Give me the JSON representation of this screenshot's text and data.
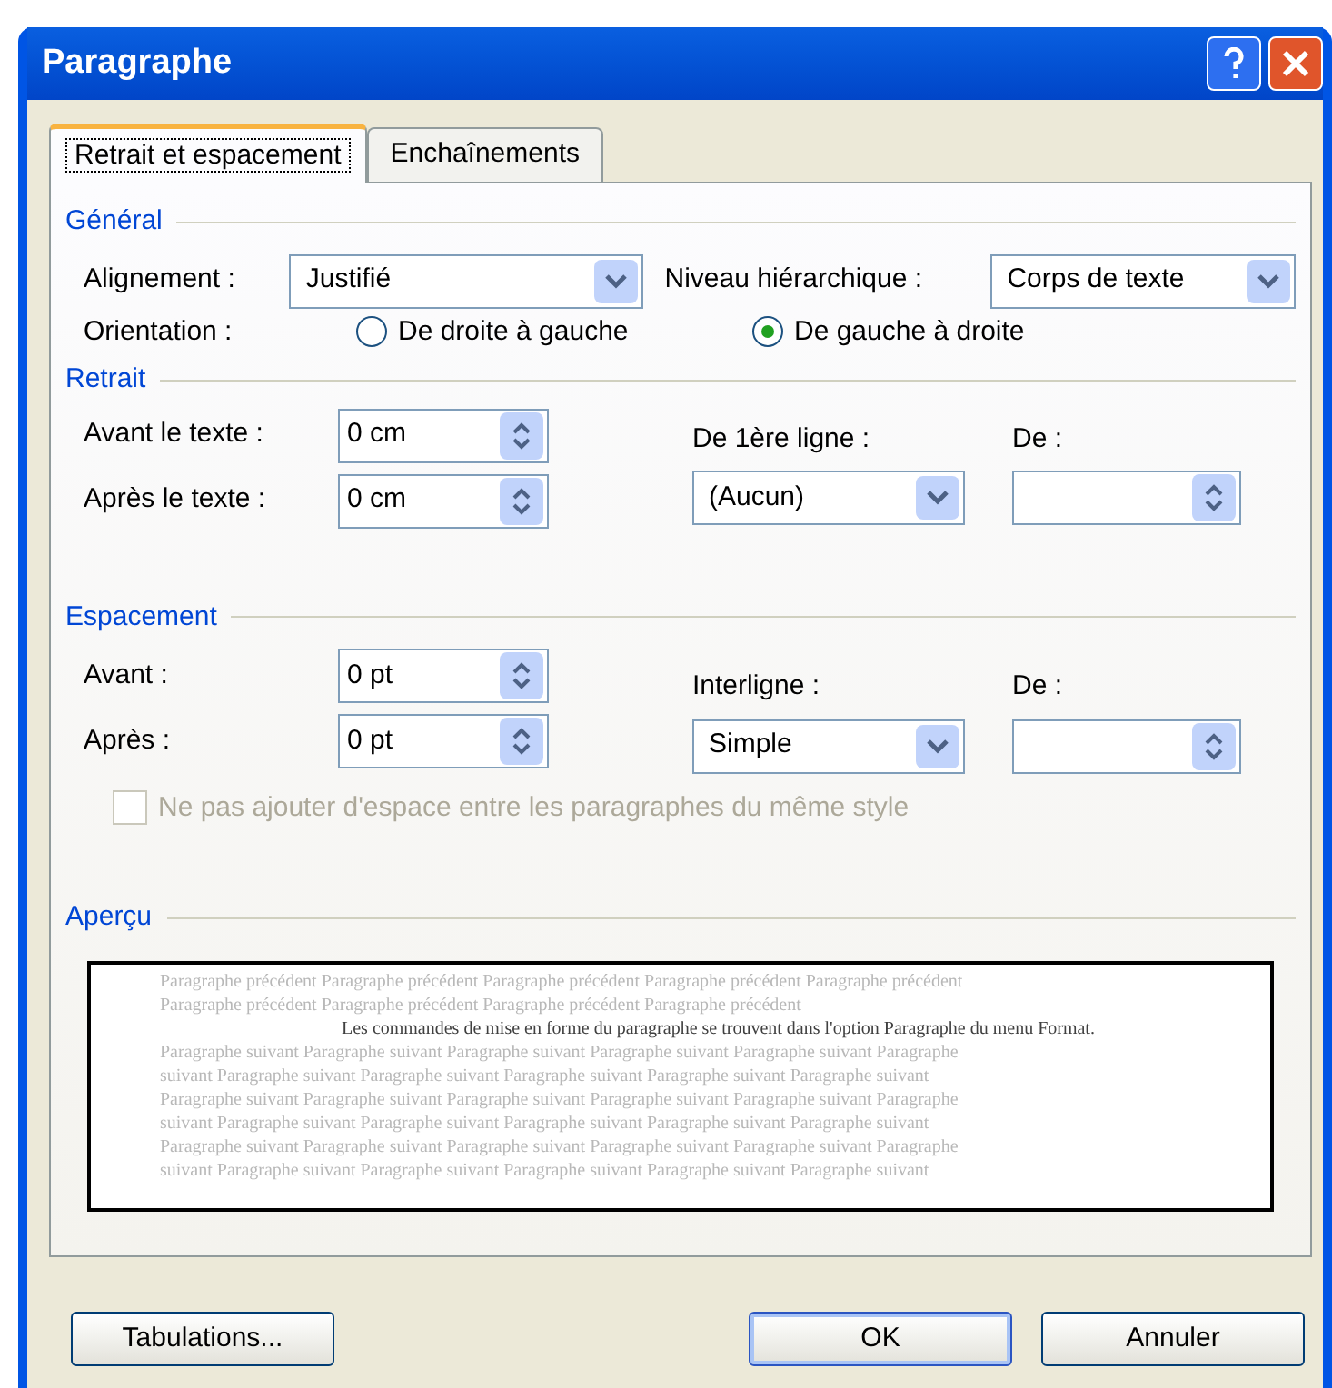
{
  "window": {
    "title": "Paragraphe"
  },
  "tabs": [
    {
      "label": "Retrait et espacement",
      "selected": true
    },
    {
      "label": "Enchaînements",
      "selected": false
    }
  ],
  "general": {
    "title": "Général",
    "alignment": {
      "label": "Alignement :",
      "value": "Justifié"
    },
    "outline_level": {
      "label": "Niveau hiérarchique :",
      "value": "Corps de texte"
    },
    "orientation": {
      "label": "Orientation :",
      "options": [
        {
          "label": "De droite à gauche",
          "selected": false
        },
        {
          "label": "De gauche à droite",
          "selected": true
        }
      ]
    }
  },
  "indent": {
    "title": "Retrait",
    "before": {
      "label": "Avant le texte :",
      "value": "0 cm"
    },
    "after": {
      "label": "Après le texte :",
      "value": "0 cm"
    },
    "first_line": {
      "label": "De 1ère ligne :",
      "value": "(Aucun)"
    },
    "by": {
      "label": "De :"
    }
  },
  "spacing": {
    "title": "Espacement",
    "before": {
      "label": "Avant :",
      "value": "0 pt"
    },
    "after": {
      "label": "Après :",
      "value": "0 pt"
    },
    "line_spacing": {
      "label": "Interligne :",
      "value": "Simple"
    },
    "at": {
      "label": "De :"
    },
    "no_space_checkbox": {
      "label": "Ne pas ajouter d'espace entre les paragraphes du même style",
      "checked": false,
      "disabled": true
    }
  },
  "preview": {
    "title": "Aperçu",
    "lines": [
      {
        "kind": "previous",
        "text": "Paragraphe précédent Paragraphe précédent Paragraphe précédent Paragraphe précédent Paragraphe précédent"
      },
      {
        "kind": "previous",
        "text": "Paragraphe précédent Paragraphe précédent Paragraphe précédent Paragraphe précédent"
      },
      {
        "kind": "current",
        "text": "Les commandes de mise en forme du paragraphe se trouvent dans l'option Paragraphe du menu Format."
      },
      {
        "kind": "following",
        "text": "Paragraphe suivant Paragraphe suivant Paragraphe suivant Paragraphe suivant Paragraphe suivant Paragraphe"
      },
      {
        "kind": "following",
        "text": "suivant Paragraphe suivant Paragraphe suivant Paragraphe suivant Paragraphe suivant Paragraphe suivant"
      },
      {
        "kind": "following",
        "text": "Paragraphe suivant Paragraphe suivant Paragraphe suivant Paragraphe suivant Paragraphe suivant Paragraphe"
      },
      {
        "kind": "following",
        "text": "suivant Paragraphe suivant Paragraphe suivant Paragraphe suivant Paragraphe suivant Paragraphe suivant"
      },
      {
        "kind": "following",
        "text": "Paragraphe suivant Paragraphe suivant Paragraphe suivant Paragraphe suivant Paragraphe suivant Paragraphe"
      },
      {
        "kind": "following",
        "text": "suivant Paragraphe suivant Paragraphe suivant Paragraphe suivant Paragraphe suivant Paragraphe suivant"
      }
    ]
  },
  "buttons": [
    {
      "label": "Tabulations...",
      "kind": "left",
      "default": false
    },
    {
      "label": "OK",
      "kind": "right",
      "default": true
    },
    {
      "label": "Annuler",
      "kind": "right",
      "default": false
    }
  ]
}
